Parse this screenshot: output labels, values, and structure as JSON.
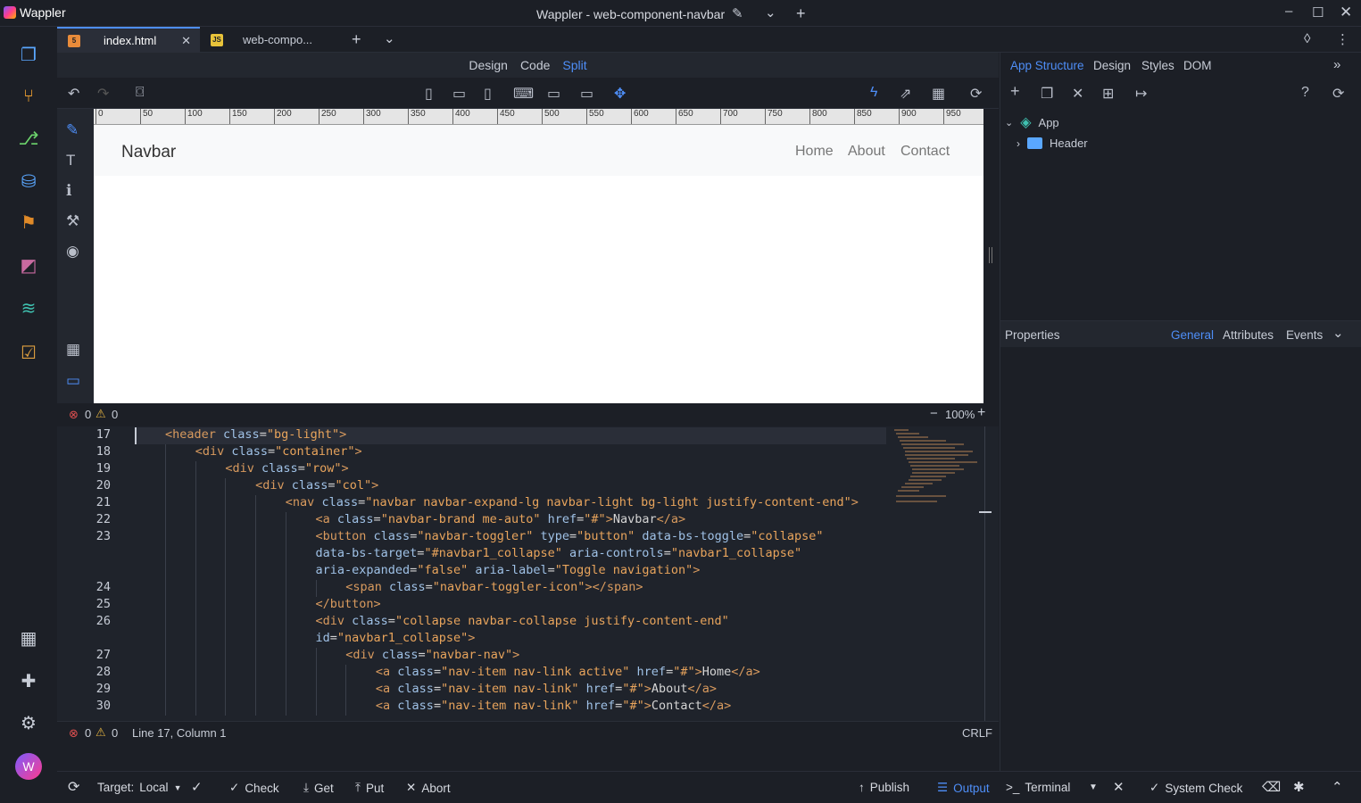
{
  "titlebar": {
    "app_name": "Wappler",
    "window_title": "Wappler - web-component-navbar"
  },
  "tabs": [
    {
      "label": "index.html",
      "type": "html"
    },
    {
      "label": "web-compo...",
      "type": "js"
    }
  ],
  "view_modes": [
    "Design",
    "Code",
    "Split"
  ],
  "active_view": "Split",
  "ruler": [
    "0",
    "50",
    "100",
    "150",
    "200",
    "250",
    "300",
    "350",
    "400",
    "450",
    "500",
    "550",
    "600",
    "650",
    "700",
    "750",
    "800",
    "850",
    "900",
    "950"
  ],
  "preview": {
    "brand": "Navbar",
    "links": [
      "Home",
      "About",
      "Contact"
    ]
  },
  "design_status": {
    "errors": "0",
    "warnings": "0",
    "zoom": "100%"
  },
  "code_lines": [
    {
      "n": "17",
      "indent": 1,
      "html": "<span class='tg'>&lt;header</span> <span class='at'>class</span><span class='pn'>=</span><span class='st'>\"bg-light\"</span><span class='tg'>&gt;</span>"
    },
    {
      "n": "18",
      "indent": 2,
      "html": "<span class='tg'>&lt;div</span> <span class='at'>class</span>=<span class='st'>\"container\"</span><span class='tg'>&gt;</span>"
    },
    {
      "n": "19",
      "indent": 3,
      "html": "<span class='tg'>&lt;div</span> <span class='at'>class</span>=<span class='st'>\"row\"</span><span class='tg'>&gt;</span>"
    },
    {
      "n": "20",
      "indent": 4,
      "html": "<span class='tg'>&lt;div</span> <span class='at'>class</span>=<span class='st'>\"col\"</span><span class='tg'>&gt;</span>"
    },
    {
      "n": "21",
      "indent": 5,
      "html": "<span class='tg'>&lt;nav</span> <span class='at'>class</span>=<span class='st'>\"navbar navbar-expand-lg navbar-light bg-light justify-content-end\"</span><span class='tg'>&gt;</span>"
    },
    {
      "n": "22",
      "indent": 6,
      "html": "<span class='tg'>&lt;a</span> <span class='at'>class</span>=<span class='st'>\"navbar-brand me-auto\"</span> <span class='at'>href</span>=<span class='st'>\"#\"</span><span class='tg'>&gt;</span>Navbar<span class='tg'>&lt;/a&gt;</span>"
    },
    {
      "n": "23",
      "indent": 6,
      "html": "<span class='tg'>&lt;button</span> <span class='at'>class</span>=<span class='st'>\"navbar-toggler\"</span> <span class='at'>type</span>=<span class='st'>\"button\"</span> <span class='at'>data-bs-toggle</span>=<span class='st'>\"collapse\"</span>"
    },
    {
      "n": "",
      "indent": 6,
      "html": "<span class='at'>data-bs-target</span>=<span class='st'>\"#navbar1_collapse\"</span> <span class='at'>aria-controls</span>=<span class='st'>\"navbar1_collapse\"</span>"
    },
    {
      "n": "",
      "indent": 6,
      "html": "<span class='at'>aria-expanded</span>=<span class='st'>\"false\"</span> <span class='at'>aria-label</span>=<span class='st'>\"Toggle navigation\"</span><span class='tg'>&gt;</span>"
    },
    {
      "n": "24",
      "indent": 7,
      "html": "<span class='tg'>&lt;span</span> <span class='at'>class</span>=<span class='st'>\"navbar-toggler-icon\"</span><span class='tg'>&gt;&lt;/span&gt;</span>"
    },
    {
      "n": "25",
      "indent": 6,
      "html": "<span class='tg'>&lt;/button&gt;</span>"
    },
    {
      "n": "26",
      "indent": 6,
      "html": "<span class='tg'>&lt;div</span> <span class='at'>class</span>=<span class='st'>\"collapse navbar-collapse justify-content-end\"</span>"
    },
    {
      "n": "",
      "indent": 6,
      "html": "<span class='at'>id</span>=<span class='st'>\"navbar1_collapse\"</span><span class='tg'>&gt;</span>"
    },
    {
      "n": "27",
      "indent": 7,
      "html": "<span class='tg'>&lt;div</span> <span class='at'>class</span>=<span class='st'>\"navbar-nav\"</span><span class='tg'>&gt;</span>"
    },
    {
      "n": "28",
      "indent": 8,
      "html": "<span class='tg'>&lt;a</span> <span class='at'>class</span>=<span class='st'>\"nav-item nav-link active\"</span> <span class='at'>href</span>=<span class='st'>\"#\"</span><span class='tg'>&gt;</span>Home<span class='tg'>&lt;/a&gt;</span>"
    },
    {
      "n": "29",
      "indent": 8,
      "html": "<span class='tg'>&lt;a</span> <span class='at'>class</span>=<span class='st'>\"nav-item nav-link\"</span> <span class='at'>href</span>=<span class='st'>\"#\"</span><span class='tg'>&gt;</span>About<span class='tg'>&lt;/a&gt;</span>"
    },
    {
      "n": "30",
      "indent": 8,
      "html": "<span class='tg'>&lt;a</span> <span class='at'>class</span>=<span class='st'>\"nav-item nav-link\"</span> <span class='at'>href</span>=<span class='st'>\"#\"</span><span class='tg'>&gt;</span>Contact<span class='tg'>&lt;/a&gt;</span>"
    }
  ],
  "code_status": {
    "errors": "0",
    "warnings": "0",
    "position": "Line 17, Column 1",
    "eol": "CRLF"
  },
  "bottombar": {
    "target_label": "Target:",
    "target_value": "Local",
    "check": "Check",
    "get": "Get",
    "put": "Put",
    "abort": "Abort",
    "publish": "Publish",
    "output": "Output",
    "terminal": "Terminal",
    "system_check": "System Check"
  },
  "right_panel": {
    "tabs": [
      "App Structure",
      "Design",
      "Styles",
      "DOM"
    ],
    "active_tab": "App Structure",
    "tree": [
      {
        "label": "App",
        "expanded": true
      },
      {
        "label": "Header",
        "expanded": false
      }
    ],
    "props_title": "Properties",
    "props_tabs": [
      "General",
      "Attributes",
      "Events"
    ],
    "active_props_tab": "General"
  },
  "colors": {
    "accent": "#4e8ef7",
    "bg": "#1c1f26",
    "tag": "#d89a5e",
    "string": "#e8a45c",
    "attr": "#9fc1e6"
  }
}
